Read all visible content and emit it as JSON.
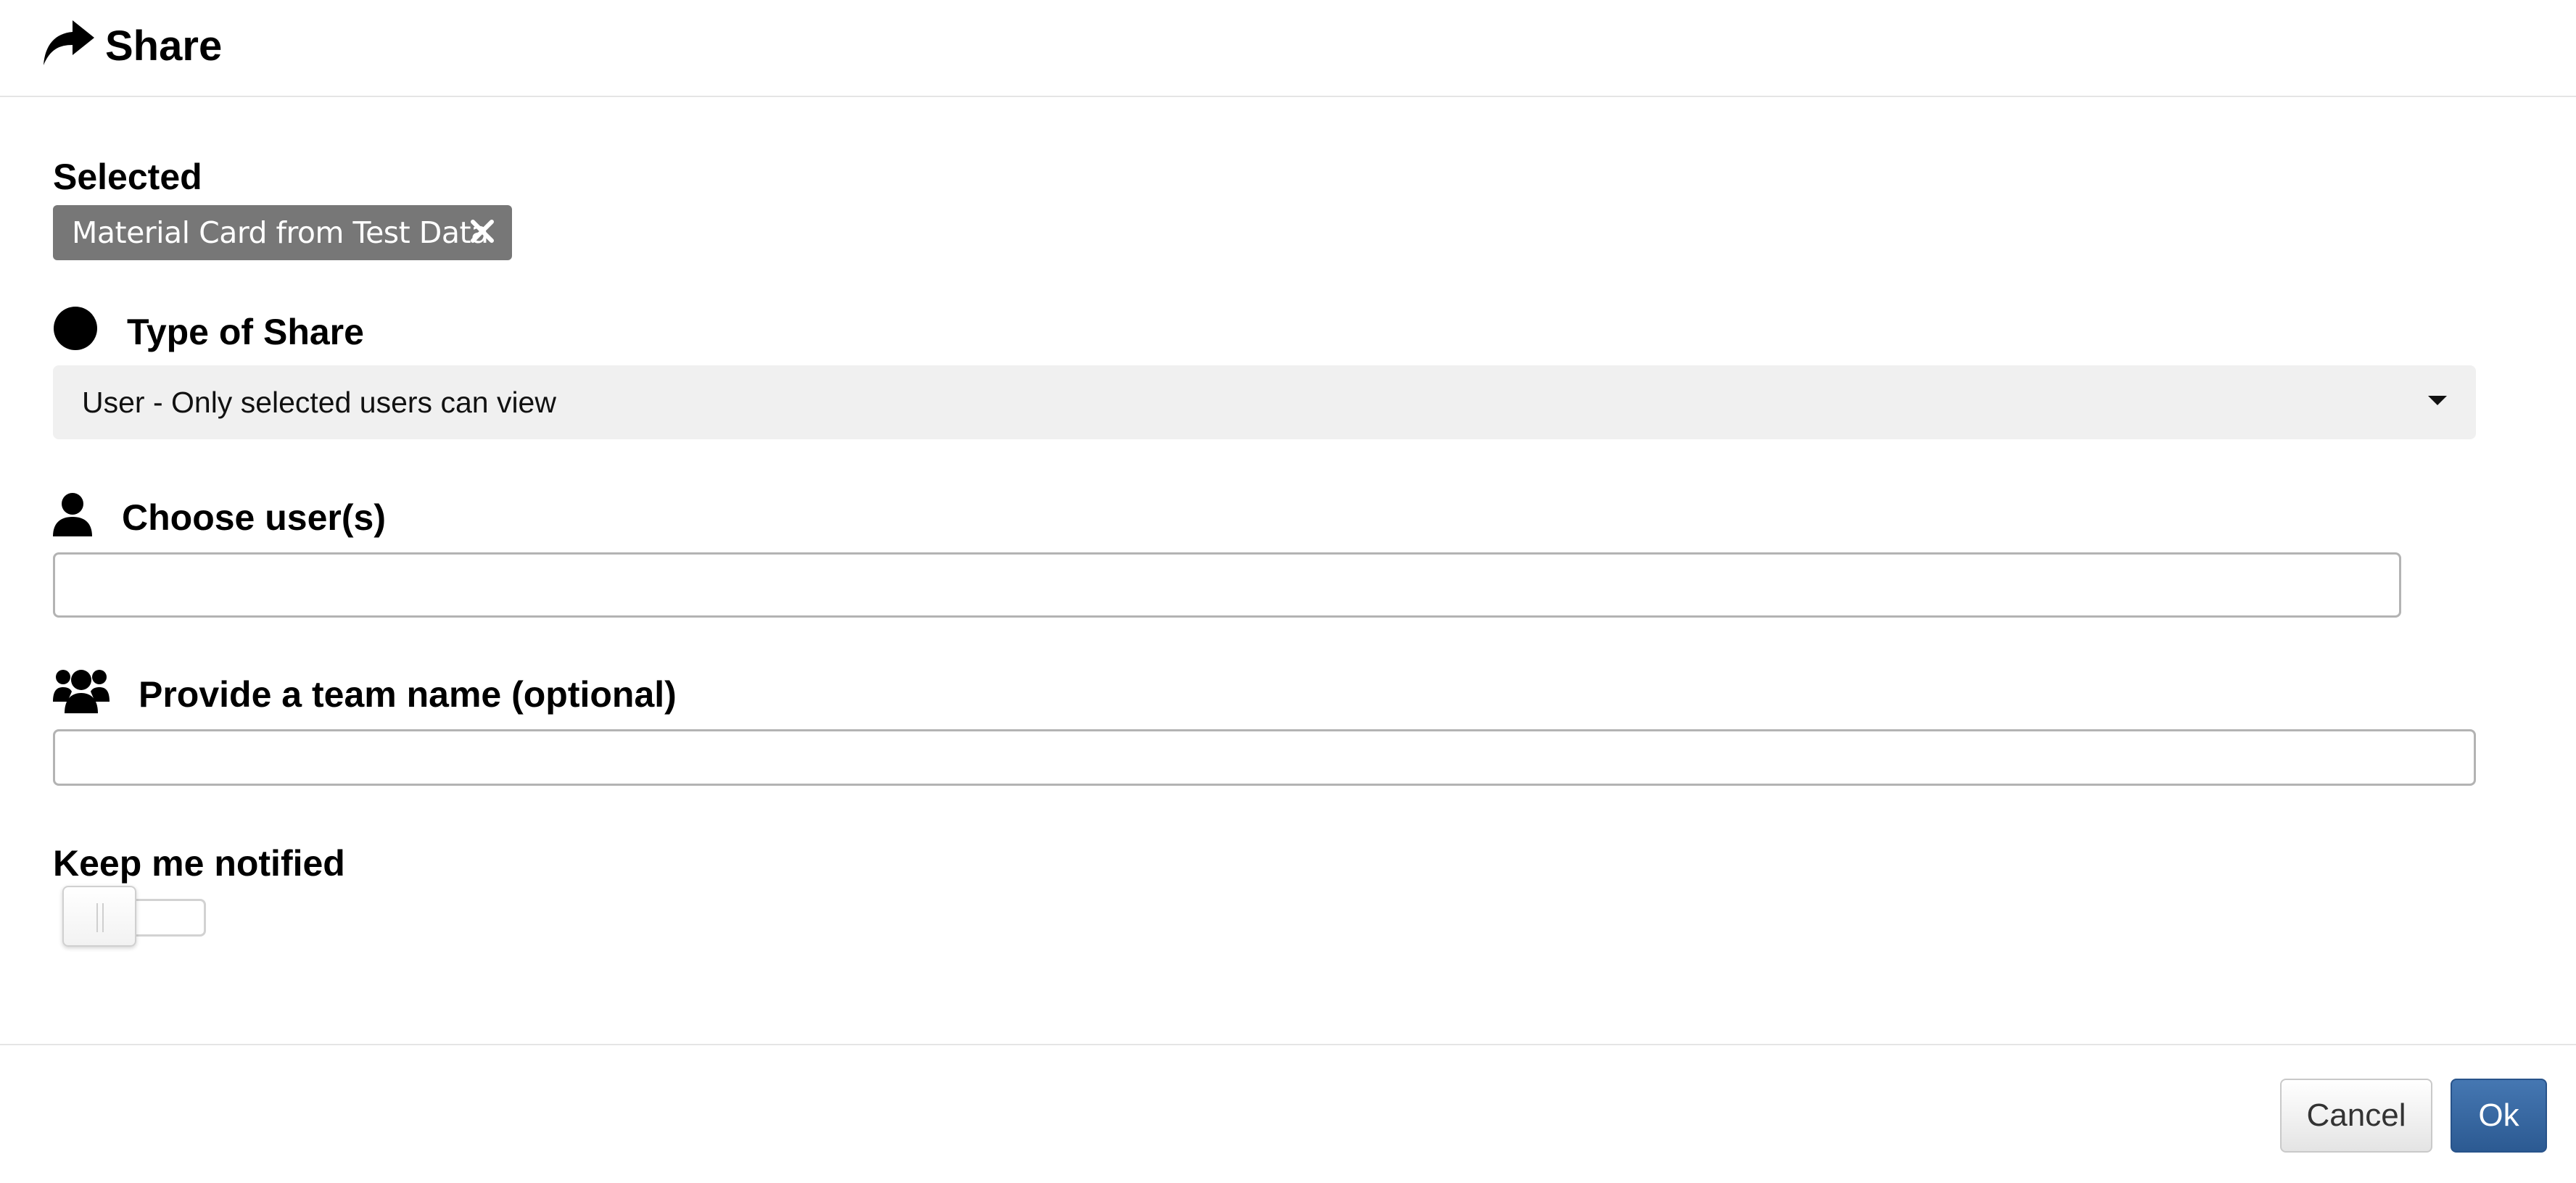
{
  "dialog": {
    "title": "Share",
    "title_icon": "share-icon"
  },
  "selected": {
    "label": "Selected",
    "chip_label": "Material Card from Test Data",
    "chip_close_icon": "close-icon"
  },
  "share_type": {
    "label": "Type of Share",
    "icon": "circle-icon",
    "selected_value": "User - Only selected users can view"
  },
  "users": {
    "label": "Choose user(s)",
    "icon": "user-icon",
    "value": ""
  },
  "team": {
    "label": "Provide a team name (optional)",
    "icon": "users-icon",
    "value": ""
  },
  "notify": {
    "label": "Keep me notified",
    "enabled": false
  },
  "footer": {
    "cancel_label": "Cancel",
    "ok_label": "Ok"
  },
  "colors": {
    "chip_bg": "#777777",
    "select_bg": "#f0f0f0",
    "ok_button_bg": "#3a6ba5"
  }
}
